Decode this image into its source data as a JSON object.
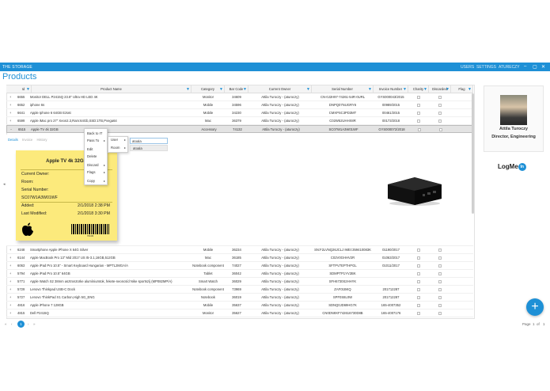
{
  "app": {
    "title": "THE STORAGE",
    "menu": [
      "USERS",
      "SETTINGS",
      "ATURECZY"
    ],
    "window_buttons": [
      "–",
      "▢",
      "✕"
    ]
  },
  "page_title": "Products",
  "columns": [
    "Id",
    "Product Name",
    "Category",
    "Bar Code",
    "Current Owner",
    "Serial Number",
    "Invoice Number",
    "Charity",
    "Discarded",
    "Flag"
  ],
  "rows_top": [
    {
      "id": "6655",
      "name": "Monitor DELL P2415Q 23.8\" Ultra HD LED 4K",
      "category": "Monitor",
      "barcode": "34609",
      "owner": "Attila Turoczy - (aturoczy)",
      "serial": "CN-0J2H97-74261-54R-0URL",
      "invoice": "GYS000043/2015"
    },
    {
      "id": "6652",
      "name": "iphone 6s",
      "category": "Mobile",
      "barcode": "34596",
      "owner": "Attila Turoczy - (aturoczy)",
      "serial": "DNPQ07NUGRY6",
      "invoice": "00989/2015"
    },
    {
      "id": "6641",
      "name": "Apple Iphone 6 64GB Ezüst",
      "category": "Mobile",
      "barcode": "34230",
      "owner": "Attila Turoczy - (aturoczy)",
      "serial": "CMXPSC3PD3MT",
      "invoice": "00461/2015"
    },
    {
      "id": "6599",
      "name": "Apple iMac pro 27\" Xeon2.3,Ram:64Gb,SSD:1TB,Pvega64",
      "category": "Mac",
      "barcode": "36379",
      "owner": "Attila Turoczy - (aturoczy)",
      "serial": "C02W52UHHX8R",
      "invoice": "00173/2018"
    },
    {
      "id": "6515",
      "name": "Apple TV 4k 32GB",
      "category": "Accessory",
      "barcode": "74132",
      "owner": "Attila Turoczy - (aturoczy)",
      "serial": "SC07W1A3W01WF",
      "invoice": "GYS000072/2018"
    }
  ],
  "rows_bottom": [
    {
      "id": "6248",
      "name": "Smartphone Apple iPhone X 64G Silver",
      "category": "Mobile",
      "barcode": "36234",
      "owner": "Attila Turoczy - (aturoczy)",
      "serial": "SN:F2LVNQ26JCLJ IMEI:359410083K",
      "invoice": "01190/2017"
    },
    {
      "id": "6144",
      "name": "Apple MacBook Pro 13\" Mid 2017 US I5-3.1,16GB,512GB",
      "category": "Mac",
      "barcode": "36185",
      "owner": "Attila Turoczy - (aturoczy)",
      "serial": "C02V0GHHV2R",
      "invoice": "01063/2017"
    },
    {
      "id": "6063",
      "name": "Apple iPad Pro 10.5\" - Smart Keyboard Hungarian - MPTL2MGA/A",
      "category": "Notebook component",
      "barcode": "74027",
      "owner": "Attila Turoczy - (aturoczy)",
      "serial": "SFTPV7EPTHPGL",
      "invoice": "01011/2017"
    },
    {
      "id": "5794",
      "name": "Apple iPad Pro 10.5\" 64GB",
      "category": "Tablet",
      "barcode": "36042",
      "owner": "Attila Turoczy - (aturoczy)",
      "serial": "SDMPTP1YV2BK",
      "invoice": ""
    },
    {
      "id": "5771",
      "name": "Apple Watch S2 38mm asztroszürke alumíniumtok, fekete-neoncsíd Nike sportszíj (MP082MP/A)",
      "category": "Smart Watch",
      "barcode": "36029",
      "owner": "Attila Turoczy - (aturoczy)",
      "serial": "SFH6730S2HHYK",
      "invoice": ""
    },
    {
      "id": "5729",
      "name": "Lenovo Thinkpad USB-C Dock",
      "category": "Notebook component",
      "barcode": "73969",
      "owner": "Attila Turoczy - (aturoczy)",
      "serial": "ZAF01BKQ",
      "invoice": "201712287"
    },
    {
      "id": "5727",
      "name": "Lenovo ThinkPad X1 Carbon,High 5G_ENG",
      "category": "Notebook",
      "barcode": "36019",
      "owner": "Attila Turoczy - (aturoczy)",
      "serial": "SPF0S8L0W",
      "invoice": "201712287"
    },
    {
      "id": "4816",
      "name": "Apple iPhone 7 128GB",
      "category": "Mobile",
      "barcode": "35637",
      "owner": "Attila Turoczy - (aturoczy)",
      "serial": "SDNQ0JD69HG7K",
      "invoice": "165-4007352"
    },
    {
      "id": "4815",
      "name": "Dell P2415Q",
      "category": "Monitor",
      "barcode": "35627",
      "owner": "Attila Turoczy - (aturoczy)",
      "serial": "CN0DN9XF742616730D8B",
      "invoice": "165-4007176"
    }
  ],
  "detail": {
    "tabs": [
      "Details",
      "Invoice",
      "History"
    ],
    "card_title": "Apple TV 4k 32GB",
    "current_owner_label": "Current Owner:",
    "room_label": "Room:",
    "serial_label": "Serial Number:",
    "serial_value": "SC07W1A3W01WF",
    "added_label": "Added:",
    "added_value": "2/1/2018 2:38 PM",
    "modified_label": "Last Modified:",
    "modified_value": "2/1/2018 3:30 PM",
    "barcode_number": "74132"
  },
  "context_menu": {
    "items": [
      "Back to IT",
      "Pass To",
      "Edit",
      "Delete",
      "Discard",
      "Flags",
      "Copy"
    ],
    "submenu": [
      "User",
      "Room"
    ],
    "search_value": "atoala",
    "suggestion": "atoala"
  },
  "pager": {
    "current_page": "1",
    "page_label": "Page",
    "page_value": "1",
    "of_label": "of",
    "total": "1"
  },
  "user_card": {
    "name": "Attila Turoczy",
    "role": "Director, Engineering",
    "logo_text": "LogMe",
    "logo_in": "In"
  },
  "colors": {
    "accent": "#1e90d6",
    "note": "#fcea7c"
  }
}
